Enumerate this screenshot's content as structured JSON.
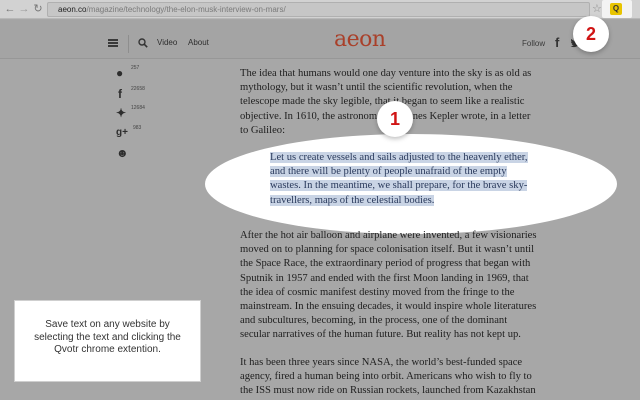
{
  "browser": {
    "url_domain": "aeon.co",
    "url_path": "/magazine/technology/the-elon-musk-interview-on-mars/",
    "star_icon": "star-icon",
    "extension_label": "Q",
    "extension_color": "#e8c400"
  },
  "header": {
    "menu_icon": "hamburger-icon",
    "search_icon": "search-icon",
    "nav_video": "Video",
    "nav_about": "About",
    "logo": "aeon",
    "logo_color": "#a9402a",
    "follow": "Follow",
    "facebook_glyph": "f"
  },
  "share": [
    {
      "icon": "comment-icon",
      "glyph": "●",
      "count": "257"
    },
    {
      "icon": "facebook-icon",
      "glyph": "f",
      "count": "22658"
    },
    {
      "icon": "twitter-icon",
      "glyph": "✦",
      "count": "12684"
    },
    {
      "icon": "google-plus-icon",
      "glyph": "g+",
      "count": "983"
    },
    {
      "icon": "reddit-icon",
      "glyph": "☻",
      "count": ""
    }
  ],
  "article": {
    "para1": [
      "The idea that humans would one day venture into the sky is as old as",
      "mythology, but it wasn’t until the scientific revolution, when the",
      "telescope made the sky legible, that it began to seem like a realistic",
      "objective. In 1610, the astronomer Johannes Kepler wrote, in a letter",
      "to Galileo:"
    ],
    "quote": [
      "Let us create vessels and sails adjusted to the heavenly ether,",
      "and there will be plenty of people unafraid of the empty",
      "wastes. In the meantime, we shall prepare, for the brave sky-",
      "travellers, maps of the celestial bodies."
    ],
    "para2": [
      "After the hot air balloon and airplane were invented, a few visionaries",
      "moved on to planning for space colonisation itself. But it wasn’t until",
      "the Space Race, the extraordinary period of progress that began with",
      "Sputnik in 1957 and ended with the first Moon landing in 1969, that",
      "the idea of cosmic manifest destiny moved from the fringe to the",
      "mainstream. In the ensuing decades, it would inspire whole literatures",
      "and subcultures, becoming, in the process, one of the dominant",
      "secular narratives of the human future. But reality has not kept up."
    ],
    "para3": [
      "It has been three years since NASA, the world’s best-funded space",
      "agency, fired a human being into orbit. Americans who wish to fly to",
      "the ISS must now ride on Russian rockets, launched from Kazakhstan"
    ],
    "highlight_color": "#c9d4e5"
  },
  "badges": {
    "one": "1",
    "two": "2",
    "color": "#d01414"
  },
  "info_card": {
    "text": "Save text on any website by selecting the text and clicking the Qvotr chrome extention."
  }
}
